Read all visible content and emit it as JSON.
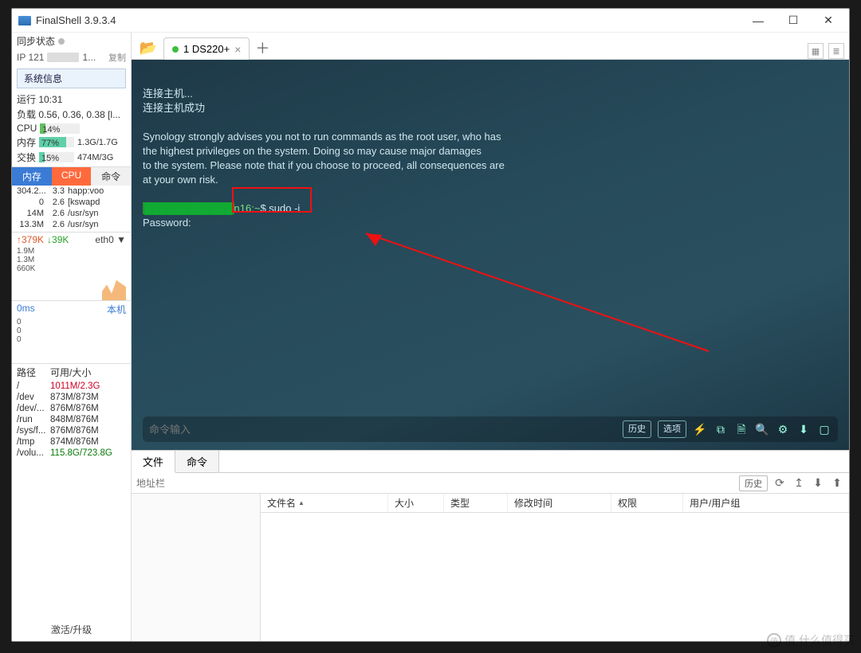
{
  "window": {
    "title": "FinalShell 3.9.3.4"
  },
  "sidebar": {
    "sync_label": "同步状态",
    "ip_prefix": "IP 121",
    "ip_suffix": "1...",
    "copy": "复制",
    "sysinfo_btn": "系统信息",
    "uptime": "运行 10:31",
    "load": "负载 0.56, 0.36, 0.38 [l...",
    "cpu_label": "CPU",
    "cpu_pct": "14%",
    "mem_label": "内存",
    "mem_pct": "77%",
    "mem_val": "1.3G/1.7G",
    "swap_label": "交换",
    "swap_pct": "15%",
    "swap_val": "474M/3G",
    "tabs": {
      "mem": "内存",
      "cpu": "CPU",
      "cmd": "命令"
    },
    "procs": [
      {
        "m": "304.2...",
        "c": "3.3",
        "n": "happ:voo"
      },
      {
        "m": "0",
        "c": "2.6",
        "n": "[kswapd"
      },
      {
        "m": "14M",
        "c": "2.6",
        "n": "/usr/syn"
      },
      {
        "m": "13.3M",
        "c": "2.6",
        "n": "/usr/syn"
      }
    ],
    "net": {
      "up": "↑379K",
      "down": "↓39K",
      "iface": "eth0 ▼"
    },
    "ylabels": [
      "1.9M",
      "1.3M",
      "660K"
    ],
    "ping": {
      "ms": "0ms",
      "local": "本机",
      "v1": "0",
      "v2": "0",
      "v3": "0"
    },
    "fs_head": {
      "path": "路径",
      "avail": "可用/大小"
    },
    "fs": [
      {
        "p": "/",
        "v": "1011M/2.3G",
        "cls": "warn"
      },
      {
        "p": "/dev",
        "v": "873M/873M"
      },
      {
        "p": "/dev/...",
        "v": "876M/876M"
      },
      {
        "p": "/run",
        "v": "848M/876M"
      },
      {
        "p": "/sys/f...",
        "v": "876M/876M"
      },
      {
        "p": "/tmp",
        "v": "874M/876M"
      },
      {
        "p": "/volu...",
        "v": "115.8G/723.8G",
        "cls": "ok"
      }
    ],
    "foot": "激活/升级"
  },
  "tabs": {
    "tab1": "1 DS220+"
  },
  "terminal": {
    "l1": "连接主机...",
    "l2": "连接主机成功",
    "warn1": "Synology strongly advises you not to run commands as the root user, who has",
    "warn2": "the highest privileges on the system. Doing so may cause major damages",
    "warn3": "to the system. Please note that if you choose to proceed, all consequences are",
    "warn4": "at your own risk.",
    "prompt_host_suffix": "n16:~",
    "prompt_cmd": "$ sudo -i",
    "password": "Password:",
    "input_placeholder": "命令输入",
    "btn_history": "历史",
    "btn_options": "选项"
  },
  "bottom": {
    "tab_file": "文件",
    "tab_cmd": "命令",
    "addr_placeholder": "地址栏",
    "history": "历史",
    "cols": {
      "name": "文件名",
      "size": "大小",
      "type": "类型",
      "mtime": "修改时间",
      "perm": "权限",
      "owner": "用户/用户组"
    }
  },
  "watermark": "值 什么值得买"
}
